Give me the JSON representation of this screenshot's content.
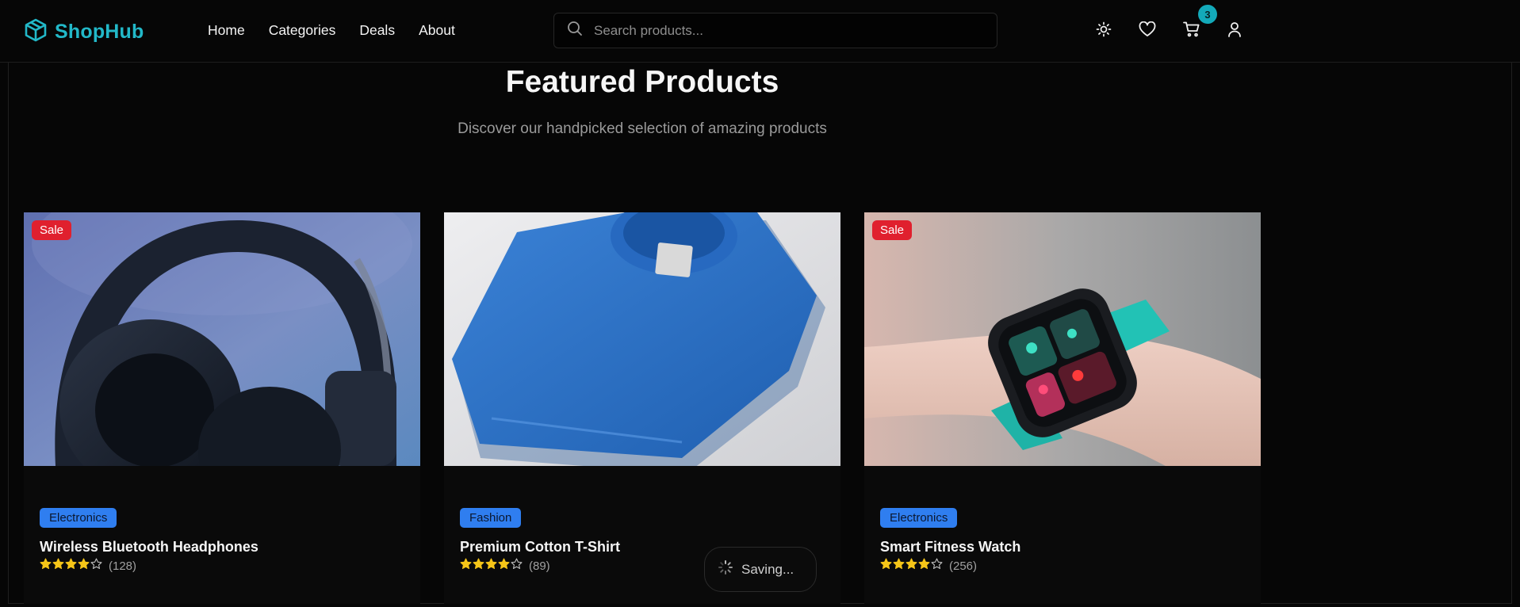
{
  "brand": {
    "name": "ShopHub",
    "color": "#22b8c8"
  },
  "nav": [
    "Home",
    "Categories",
    "Deals",
    "About"
  ],
  "search": {
    "placeholder": "Search products..."
  },
  "cart": {
    "count": "3"
  },
  "hero": {
    "title": "Featured Products",
    "subtitle": "Discover our handpicked selection of amazing products"
  },
  "products": [
    {
      "name": "Wireless Bluetooth Headphones",
      "category": "Electronics",
      "badge": "Sale",
      "rating": 4,
      "reviews": "(128)",
      "image": "headphones"
    },
    {
      "name": "Premium Cotton T-Shirt",
      "category": "Fashion",
      "badge": "",
      "rating": 4,
      "reviews": "(89)",
      "image": "t-shirt"
    },
    {
      "name": "Smart Fitness Watch",
      "category": "Electronics",
      "badge": "Sale",
      "rating": 4,
      "reviews": "(256)",
      "image": "smart-watch"
    }
  ],
  "toast": {
    "text": "Saving..."
  },
  "colors": {
    "sale": "#e0202e",
    "category": "#2f7ef0",
    "star": "#f5c518",
    "accent": "#13a9b9"
  }
}
